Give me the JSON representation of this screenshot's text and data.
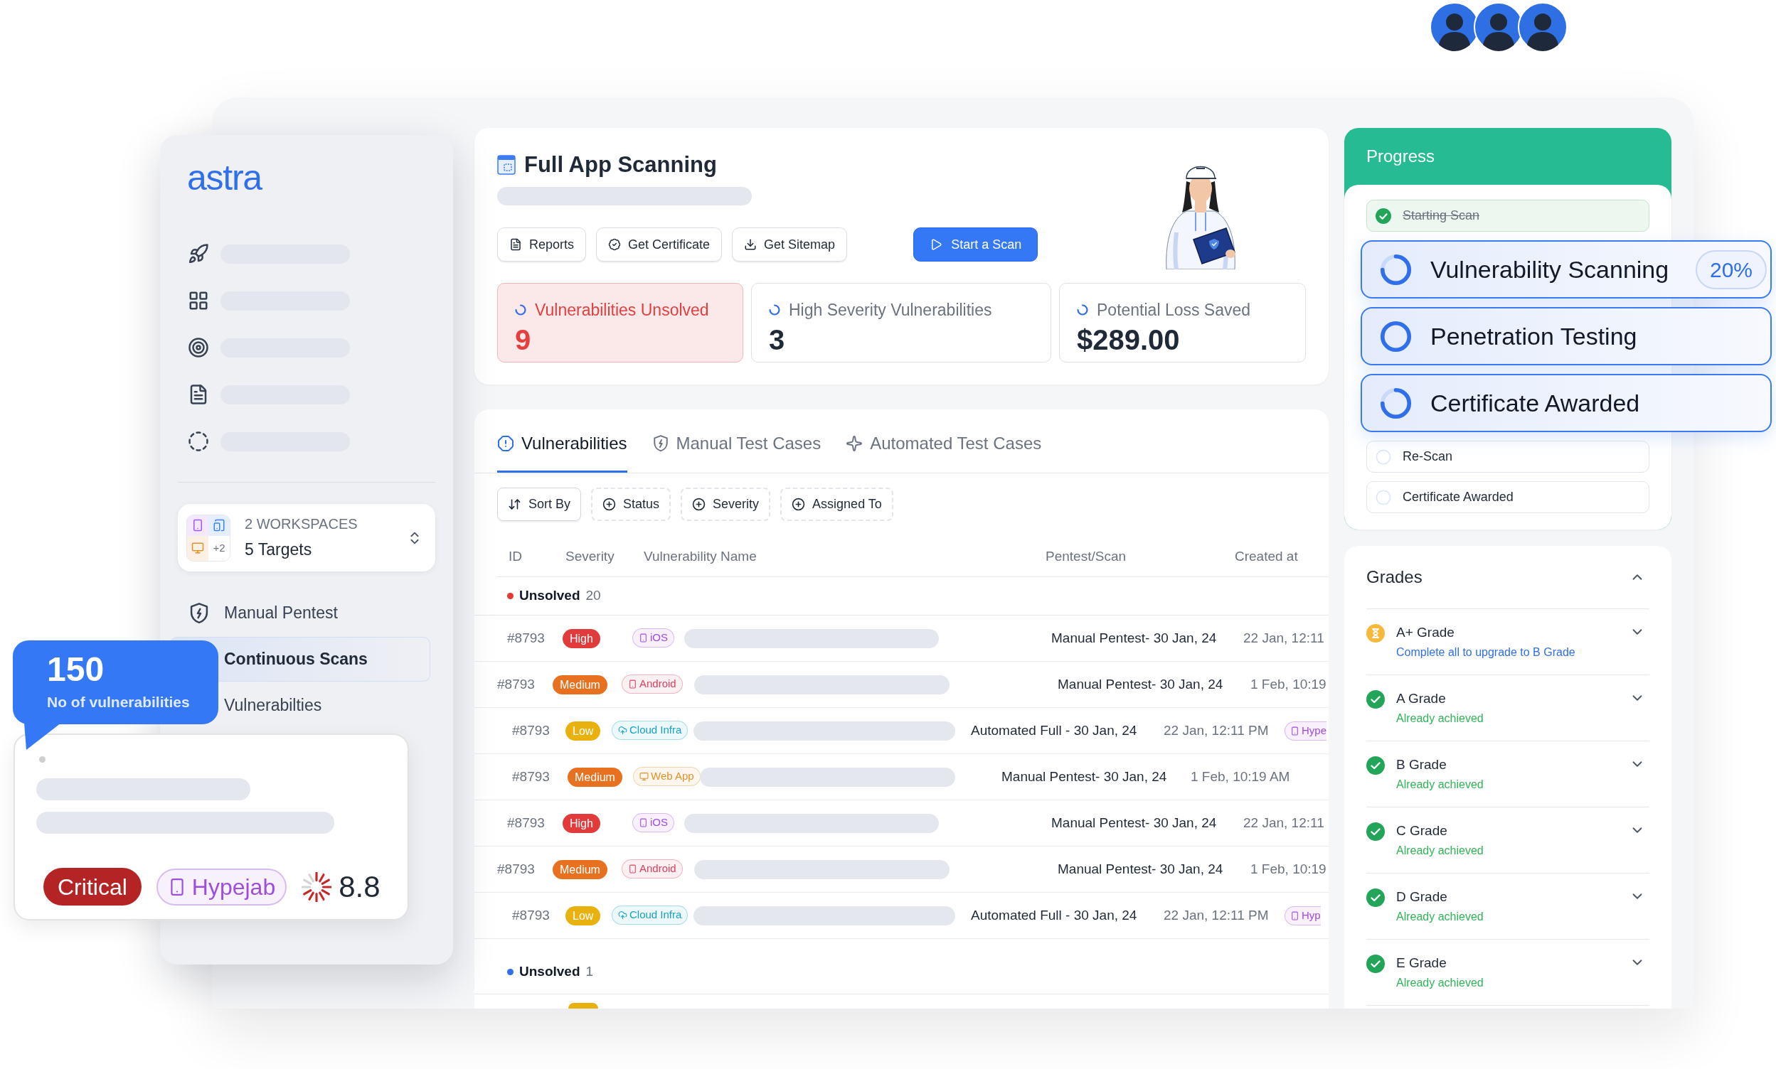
{
  "avatars": [
    {
      "kind": "person"
    },
    {
      "kind": "person"
    },
    {
      "kind": "person"
    }
  ],
  "sidebar": {
    "logo": "astra",
    "nav": [
      {
        "kind": "rocket"
      },
      {
        "kind": "grid"
      },
      {
        "kind": "target"
      },
      {
        "kind": "report"
      },
      {
        "kind": "scan"
      }
    ],
    "workspace": {
      "tiles": [
        {
          "kind": "phone",
          "color": "#a855f7"
        },
        {
          "kind": "devices",
          "color": "#3b82f6"
        },
        {
          "kind": "monitor",
          "color": "#e0922a"
        }
      ],
      "more": "+2",
      "overline": "2 WORKSPACES",
      "title": "5 Targets"
    },
    "items": [
      {
        "label": "Manual Pentest",
        "kind": "shield",
        "selected": false
      },
      {
        "label": "Continuous Scans",
        "selected": true
      },
      {
        "label": "Vulnerabilties",
        "selected": false
      }
    ]
  },
  "tooltip": {
    "value": "150",
    "caption": "No of vulnerabilities"
  },
  "finding_card": {
    "severity": {
      "label": "Critical",
      "color": "#b42424"
    },
    "target": {
      "label": "Hypejab",
      "kind": "phone",
      "color": "#9d4edd"
    },
    "score": "8.8"
  },
  "header": {
    "title": "Full App Scanning",
    "buttons": [
      {
        "label": "Reports",
        "kind": "report"
      },
      {
        "label": "Get Certificate",
        "kind": "certificate"
      },
      {
        "label": "Get Sitemap",
        "kind": "download"
      }
    ],
    "primary_button": "Start a Scan",
    "stats": [
      {
        "label": "Vulnerabilities Unsolved",
        "value": "9",
        "alert": true
      },
      {
        "label": "High Severity Vulnerabilities",
        "value": "3",
        "alert": false
      },
      {
        "label": "Potential Loss Saved",
        "value": "$289.00",
        "alert": false
      }
    ]
  },
  "tabs": [
    {
      "label": "Vulnerabilities",
      "kind": "alert",
      "selected": true
    },
    {
      "label": "Manual Test Cases",
      "kind": "shield",
      "selected": false
    },
    {
      "label": "Automated Test Cases",
      "kind": "sparkle",
      "selected": false
    }
  ],
  "filters": [
    {
      "label": "Sort By",
      "kind": "sort"
    },
    {
      "label": "Status",
      "kind": "add"
    },
    {
      "label": "Severity",
      "kind": "add"
    },
    {
      "label": "Assigned To",
      "kind": "add"
    }
  ],
  "table": {
    "columns": [
      "ID",
      "Severity",
      "Vulnerability Name",
      "Pentest/Scan",
      "Created at"
    ],
    "groups": [
      {
        "label": "Unsolved",
        "count": "20",
        "color": "#e53935",
        "rows": [
          {
            "id": "#8793",
            "severity": {
              "label": "High",
              "color": "#e23b3b"
            },
            "platform": {
              "label": "iOS",
              "kind": "phone",
              "color": "#a24be0"
            },
            "pentest": "Manual Pentest- 30 Jan, 24",
            "created": "22 Jan, 12:11"
          },
          {
            "id": "#8793",
            "severity": {
              "label": "Medium",
              "color": "#e8711f"
            },
            "platform": {
              "label": "Android",
              "kind": "phone",
              "color": "#e0405e"
            },
            "pentest": "Manual Pentest- 30 Jan, 24",
            "created": "1 Feb, 10:19"
          },
          {
            "id": "#8793",
            "severity": {
              "label": "Low",
              "color": "#e9b10e"
            },
            "platform": {
              "label": "Cloud Infra",
              "kind": "cloud",
              "color": "#17a2c4"
            },
            "pentest": "Automated Full - 30 Jan, 24",
            "created": "22 Jan, 12:11 PM",
            "target": {
              "label": "Hype",
              "kind": "phone",
              "color": "#a24be0"
            }
          },
          {
            "id": "#8793",
            "severity": {
              "label": "Medium",
              "color": "#e8711f"
            },
            "platform": {
              "label": "Web App",
              "kind": "monitor",
              "color": "#e0922a"
            },
            "pentest": "Manual Pentest- 30 Jan, 24",
            "created": "1 Feb, 10:19 AM"
          },
          {
            "id": "#8793",
            "severity": {
              "label": "High",
              "color": "#e23b3b"
            },
            "platform": {
              "label": "iOS",
              "kind": "phone",
              "color": "#a24be0"
            },
            "pentest": "Manual Pentest- 30 Jan, 24",
            "created": "22 Jan, 12:11"
          },
          {
            "id": "#8793",
            "severity": {
              "label": "Medium",
              "color": "#e8711f"
            },
            "platform": {
              "label": "Android",
              "kind": "phone",
              "color": "#e0405e"
            },
            "pentest": "Manual Pentest- 30 Jan, 24",
            "created": "1 Feb, 10:19"
          },
          {
            "id": "#8793",
            "severity": {
              "label": "Low",
              "color": "#e9b10e"
            },
            "platform": {
              "label": "Cloud Infra",
              "kind": "cloud",
              "color": "#17a2c4"
            },
            "pentest": "Automated Full - 30 Jan, 24",
            "created": "22 Jan, 12:11 PM",
            "target": {
              "label": "Hyp",
              "kind": "phone",
              "color": "#a24be0"
            }
          }
        ]
      },
      {
        "label": "Unsolved",
        "count": "1",
        "color": "#2f6fec",
        "rows": [
          {
            "severity": {
              "color": "#e9b10e"
            }
          }
        ]
      }
    ]
  },
  "progress": {
    "title": "Progress",
    "steps": [
      {
        "label": "Starting Scan",
        "kind": "done",
        "highlighted": false
      },
      {
        "label": "Vulnerability Scanning",
        "kind": "running",
        "highlighted": true,
        "badge": "20%"
      },
      {
        "label": "Penetration Testing",
        "kind": "waiting",
        "highlighted": true
      },
      {
        "label": "Certificate Awarded",
        "kind": "running",
        "highlighted": true
      },
      {
        "label": "Re-Scan",
        "kind": "pending",
        "highlighted": false
      },
      {
        "label": "Certificate Awarded",
        "kind": "pending",
        "highlighted": false
      }
    ]
  },
  "grades": {
    "title": "Grades",
    "expanded": true,
    "items": [
      {
        "title": "A+ Grade",
        "subtitle": "Complete all to upgrade to B Grade",
        "achieved": false,
        "expanded": false
      },
      {
        "title": "A Grade",
        "subtitle": "Already achieved",
        "achieved": true,
        "expanded": false
      },
      {
        "title": "B Grade",
        "subtitle": "Already achieved",
        "achieved": true,
        "expanded": false
      },
      {
        "title": "C Grade",
        "subtitle": "Already achieved",
        "achieved": true,
        "expanded": false
      },
      {
        "title": "D Grade",
        "subtitle": "Already achieved",
        "achieved": true,
        "expanded": false
      },
      {
        "title": "E Grade",
        "subtitle": "Already achieved",
        "achieved": true,
        "expanded": false
      }
    ]
  }
}
